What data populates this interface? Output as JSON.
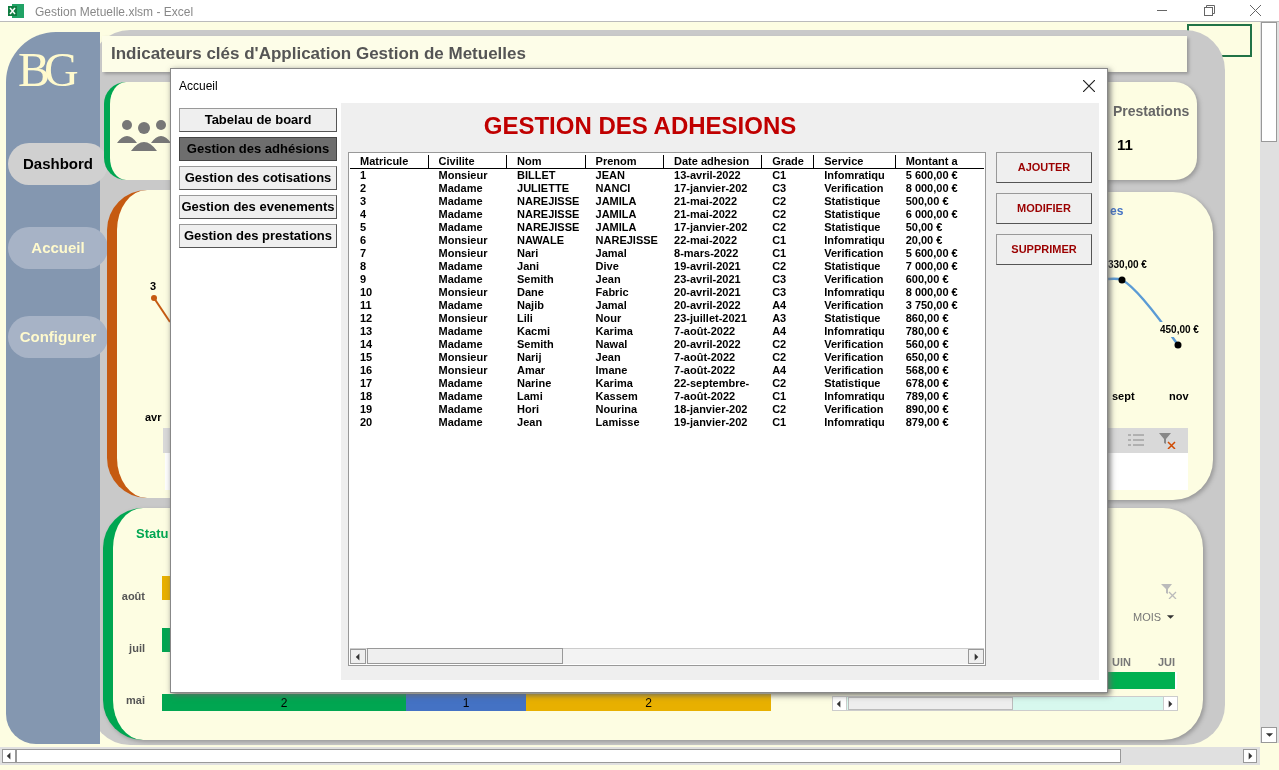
{
  "window": {
    "title": "Gestion Metuelle.xlsm - Excel"
  },
  "sidebar": {
    "logo": "BG",
    "items": [
      {
        "label": "Dashbord",
        "selected": true
      },
      {
        "label": "Accueil",
        "selected": false
      },
      {
        "label": "Configurer",
        "selected": false
      }
    ]
  },
  "header": {
    "title": "Indicateurs clés d'Application Gestion de Metuelles"
  },
  "kpi_card": {
    "label": "Prestations",
    "value": "11"
  },
  "chart_left": {
    "point_label": "3",
    "x_label": "avr"
  },
  "chart_right": {
    "title": "es",
    "point_labels": [
      "330,00 €",
      "450,00 €"
    ],
    "x_labels": [
      "sept",
      "nov"
    ]
  },
  "status_chart": {
    "title": "Statu",
    "rows": [
      {
        "label": "août"
      },
      {
        "label": "juil"
      },
      {
        "label": "mai"
      }
    ],
    "segments": [
      {
        "value": "2",
        "color": "#00a651"
      },
      {
        "value": "1",
        "color": "#4472c4"
      },
      {
        "value": "2",
        "color": "#e8b000"
      }
    ]
  },
  "timeline": {
    "filter_label": "MOIS",
    "months": [
      "UIN",
      "JUI"
    ]
  },
  "dialog": {
    "title": "Accueil",
    "menu": [
      {
        "label": "Tabelau de board",
        "selected": false
      },
      {
        "label": "Gestion des adhésions",
        "selected": true
      },
      {
        "label": "Gestion des cotisations",
        "selected": false
      },
      {
        "label": "Gestion des evenements",
        "selected": false
      },
      {
        "label": "Gestion des prestations",
        "selected": false
      }
    ],
    "heading": "GESTION DES ADHESIONS",
    "columns": [
      "Matricule",
      "Civilite",
      "Nom",
      "Prenom",
      "Date adhesion",
      "Grade",
      "Service",
      "Montant a"
    ],
    "rows": [
      [
        "1",
        "Monsieur",
        "BILLET",
        "JEAN",
        "13-avril-2022",
        "C1",
        "Infomratiqu",
        "5 600,00 €"
      ],
      [
        "2",
        "Madame",
        "JULIETTE",
        "NANCI",
        "17-janvier-202",
        "C3",
        "Verification",
        "8 000,00 €"
      ],
      [
        "3",
        "Madame",
        "NAREJISSE",
        "JAMILA",
        "21-mai-2022",
        "C2",
        "Statistique",
        "500,00 €"
      ],
      [
        "4",
        "Madame",
        "NAREJISSE",
        "JAMILA",
        "21-mai-2022",
        "C2",
        "Statistique",
        "6 000,00 €"
      ],
      [
        "5",
        "Madame",
        "NAREJISSE",
        "JAMILA",
        "17-janvier-202",
        "C2",
        "Statistique",
        "50,00 €"
      ],
      [
        "6",
        "Monsieur",
        "NAWALE",
        "NAREJISSE",
        "22-mai-2022",
        "C1",
        "Infomratiqu",
        "20,00 €"
      ],
      [
        "7",
        "Monsieur",
        "Nari",
        "Jamal",
        "8-mars-2022",
        "C1",
        "Verification",
        "5 600,00 €"
      ],
      [
        "8",
        "Madame",
        "Jani",
        "Dive",
        "19-avril-2021",
        "C2",
        "Statistique",
        "7 000,00 €"
      ],
      [
        "9",
        "Madame",
        "Semith",
        "Jean",
        "23-avril-2021",
        "C3",
        "Verification",
        "600,00 €"
      ],
      [
        "10",
        "Monsieur",
        "Dane",
        "Fabric",
        "20-avril-2021",
        "C3",
        "Infomratiqu",
        "8 000,00 €"
      ],
      [
        "11",
        "Madame",
        "Najib",
        "Jamal",
        "20-avril-2022",
        "A4",
        "Verification",
        "3 750,00 €"
      ],
      [
        "12",
        "Monsieur",
        "Lili",
        "Nour",
        "23-juillet-2021",
        "A3",
        "Statistique",
        "860,00 €"
      ],
      [
        "13",
        "Madame",
        "Kacmi",
        "Karima",
        "7-août-2022",
        "A4",
        "Infomratiqu",
        "780,00 €"
      ],
      [
        "14",
        "Madame",
        "Semith",
        "Nawal",
        "20-avril-2022",
        "C2",
        "Verification",
        "560,00 €"
      ],
      [
        "15",
        "Monsieur",
        "Narij",
        "Jean",
        "7-août-2022",
        "C2",
        "Verification",
        "650,00 €"
      ],
      [
        "16",
        "Monsieur",
        "Amar",
        "Imane",
        "7-août-2022",
        "A4",
        "Verification",
        "568,00 €"
      ],
      [
        "17",
        "Madame",
        "Narine",
        "Karima",
        "22-septembre-",
        "C2",
        "Statistique",
        "678,00 €"
      ],
      [
        "18",
        "Madame",
        "Lami",
        "Kassem",
        "7-août-2022",
        "C1",
        "Infomratiqu",
        "789,00 €"
      ],
      [
        "19",
        "Madame",
        "Hori",
        "Nourina",
        "18-janvier-202",
        "C2",
        "Verification",
        "890,00 €"
      ],
      [
        "20",
        "Madame",
        "Jean",
        "Lamisse",
        "19-janvier-202",
        "C1",
        "Infomratiqu",
        "879,00 €"
      ]
    ],
    "actions": [
      "AJOUTER",
      "MODIFIER",
      "SUPPRIMER"
    ]
  }
}
